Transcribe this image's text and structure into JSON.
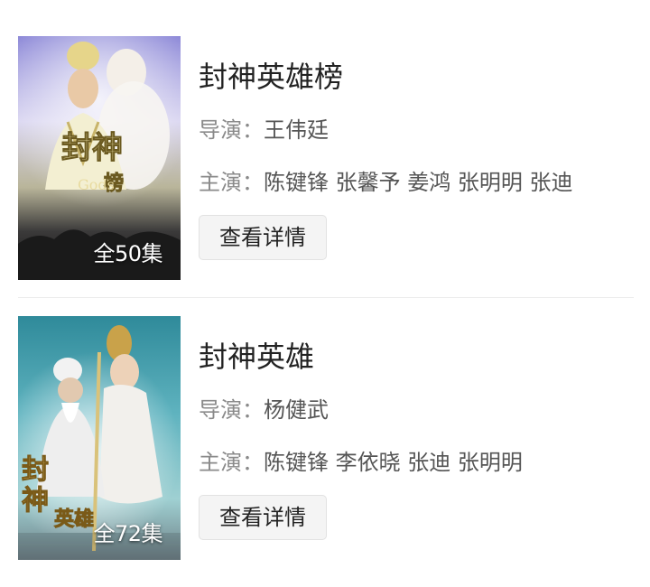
{
  "dramas": [
    {
      "title": "封神英雄榜",
      "director_label": "导演：",
      "director": "王伟廷",
      "cast_label": "主演：",
      "cast": "陈键锋 张馨予 姜鸿 张明明 张迪",
      "episodes": "全50集",
      "poster_title": "封神榜",
      "button_label": "查看详情"
    },
    {
      "title": "封神英雄",
      "director_label": "导演：",
      "director": "杨健武",
      "cast_label": "主演：",
      "cast": "陈键锋 李依晓 张迪 张明明",
      "episodes": "全72集",
      "poster_title": "封神英雄",
      "button_label": "查看详情"
    }
  ]
}
